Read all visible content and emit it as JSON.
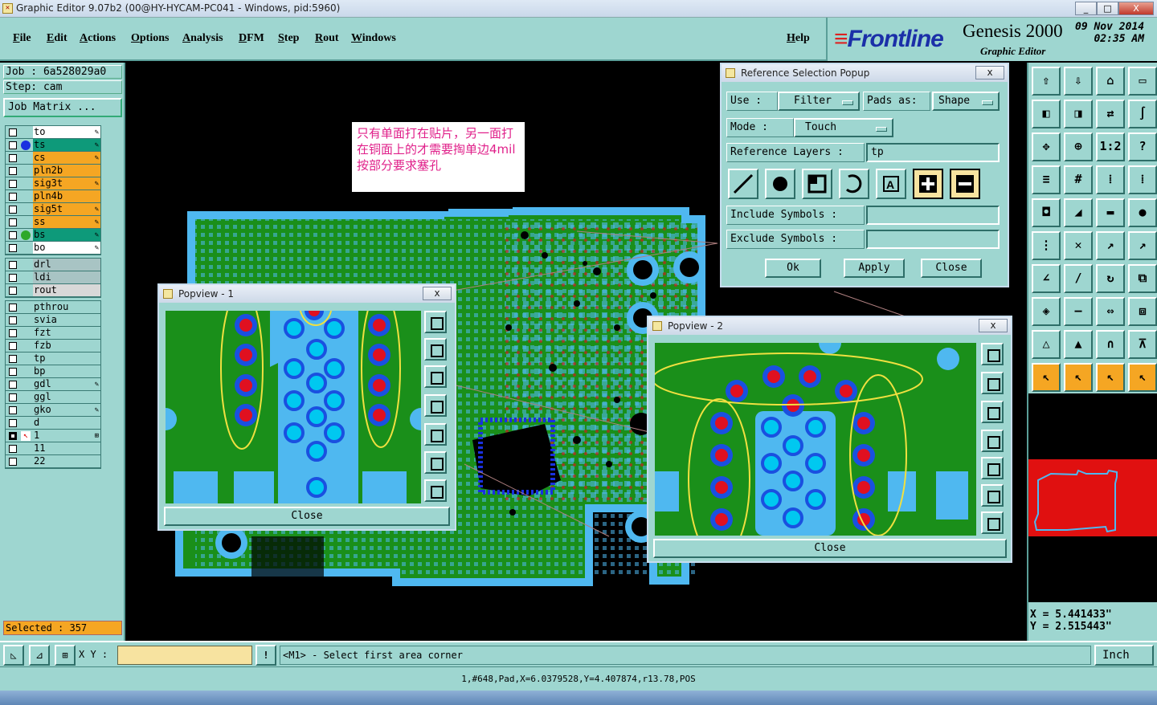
{
  "window": {
    "title": "Graphic Editor 9.07b2 (00@HY-HYCAM-PC041 - Windows, pid:5960)",
    "min": "_",
    "max": "□",
    "close": "X"
  },
  "menu": {
    "items": [
      "File",
      "Edit",
      "Actions",
      "Options",
      "Analysis",
      "DFM",
      "Step",
      "Rout",
      "Windows"
    ],
    "help": "Help"
  },
  "brand": {
    "logo": "Frontline",
    "product": "Genesis 2000",
    "subtitle": "Graphic Editor",
    "date": "09 Nov 2014",
    "time": "02:35 AM"
  },
  "job": {
    "job_label": "Job : 6a528029a0",
    "step_label": "Step: cam",
    "matrix_button": "Job Matrix ..."
  },
  "layers": {
    "group1": [
      {
        "name": "to",
        "color": "#ffffff",
        "dot": "",
        "mark": true
      },
      {
        "name": "ts",
        "color": "#0e9a7a",
        "dot": "#1a30e0",
        "mark": true
      },
      {
        "name": "cs",
        "color": "#f5a623",
        "dot": "",
        "mark": true
      },
      {
        "name": "pln2b",
        "color": "#f5a623",
        "dot": "",
        "mark": false
      },
      {
        "name": "sig3t",
        "color": "#f5a623",
        "dot": "",
        "mark": true
      },
      {
        "name": "pln4b",
        "color": "#f5a623",
        "dot": "",
        "mark": false
      },
      {
        "name": "sig5t",
        "color": "#f5a623",
        "dot": "",
        "mark": true
      },
      {
        "name": "ss",
        "color": "#f5a623",
        "dot": "",
        "mark": true
      },
      {
        "name": "bs",
        "color": "#0e9a7a",
        "dot": "#2ea82a",
        "mark": true
      },
      {
        "name": "bo",
        "color": "#ffffff",
        "dot": "",
        "mark": true
      }
    ],
    "group2": [
      {
        "name": "drl",
        "color": "#a8c4c4"
      },
      {
        "name": "ldi",
        "color": "#a8c4c4"
      },
      {
        "name": "rout",
        "color": "#d8d8d8"
      }
    ],
    "group3": [
      {
        "name": "pthrou",
        "mark": false
      },
      {
        "name": "svia",
        "mark": false
      },
      {
        "name": "fzt",
        "mark": false
      },
      {
        "name": "fzb",
        "mark": false
      },
      {
        "name": "tp",
        "mark": false
      },
      {
        "name": "bp",
        "mark": false
      },
      {
        "name": "gdl",
        "mark": true
      },
      {
        "name": "ggl",
        "mark": false
      },
      {
        "name": "gko",
        "mark": true
      },
      {
        "name": "d",
        "mark": false
      },
      {
        "name": "1",
        "mark": true,
        "active": true
      },
      {
        "name": "11",
        "mark": false
      },
      {
        "name": "22",
        "mark": false
      }
    ]
  },
  "selected": "Selected : 357",
  "note_text": "只有单面打在贴片，另一面打在铜面上的才需要掏单边4mil按部分要求塞孔",
  "popview1": {
    "title": "Popview - 1",
    "close": "Close",
    "x_label": "x"
  },
  "popview2": {
    "title": "Popview - 2",
    "close": "Close",
    "x_label": "x"
  },
  "refpopup": {
    "title": "Reference Selection Popup",
    "x_label": "x",
    "use_label": "Use  :",
    "use_value": "Filter",
    "pads_label": "Pads as:",
    "pads_value": "Shape",
    "mode_label": "Mode  :",
    "mode_value": "Touch",
    "ref_layers_label": "Reference Layers :",
    "ref_layers_value": "tp",
    "include_label": "Include Symbols :",
    "include_value": "",
    "exclude_label": "Exclude Symbols :",
    "exclude_value": "",
    "ok": "Ok",
    "apply": "Apply",
    "close": "Close"
  },
  "toolbar_glyphs": [
    "1:2",
    "?"
  ],
  "coords": {
    "x": "X = 5.441433\"",
    "y": "Y = 2.515443\""
  },
  "bottom": {
    "xy_label": "X Y :",
    "xy_value": "",
    "warn": "!",
    "prompt": "<M1> - Select first area corner",
    "unit": "Inch"
  },
  "status": "1,#648,Pad,X=6.0379528,Y=4.407874,r13.78,POS",
  "colors": {
    "board": "#1a8f1a",
    "copper": "#4fb8f0",
    "pad": "#e01020",
    "via": "#1a50e0",
    "panel": "#9ed6d0"
  }
}
